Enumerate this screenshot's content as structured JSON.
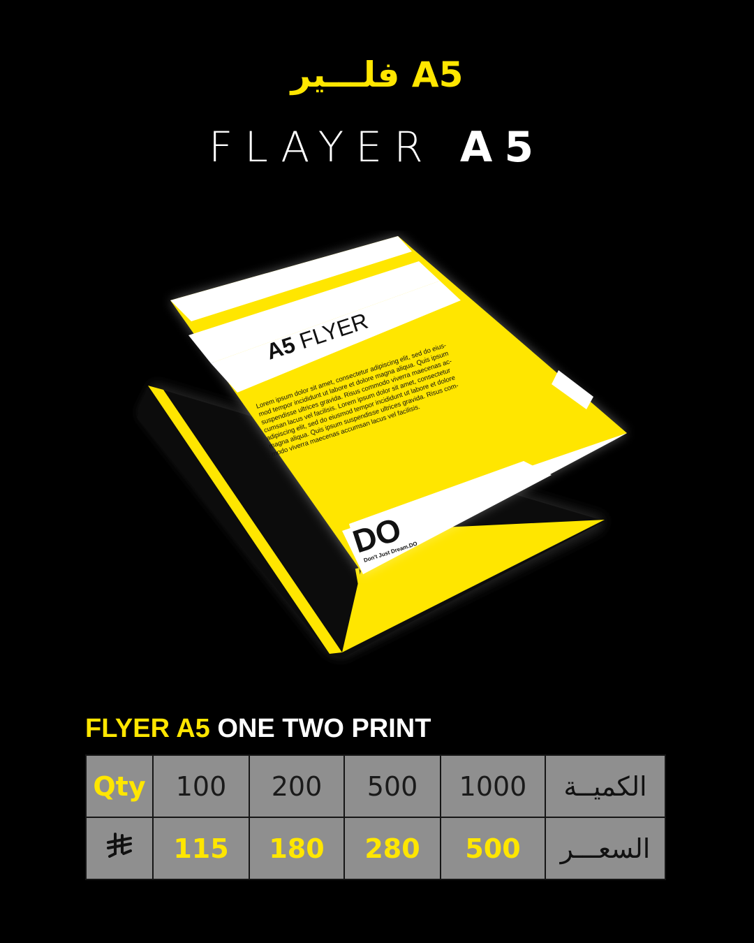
{
  "header": {
    "title_ar": "فلـــير A5",
    "title_en_light": "FLAYER",
    "title_en_bold": "A5"
  },
  "mockup": {
    "front_heading_bold": "A5",
    "front_heading_light": "FLYER",
    "body_lines": [
      "Lorem ipsum dolor sit amet, consectetur adipiscing elit, sed do eius-",
      "mod tempor incididunt ut labore et dolore magna aliqua. Quis ipsum",
      "suspendisse ultrices gravida. Risus commodo viverra maecenas ac-",
      "cumsan lacus vel facilisis. Lorem ipsum dolor sit amet, consectetur",
      "adipiscing elit, sed do eiusmod tempor incididunt ut labore et dolore",
      "magna aliqua. Quis ipsum suspendisse ultrices gravida. Risus com-",
      "modo viverra maecenas accumsan lacus vel facilisis."
    ],
    "logo": "DO",
    "tagline": "Don't Just Dream.DO",
    "back_text": "A5 FLYER"
  },
  "subheading": {
    "accent": "FLYER A5",
    "rest": "ONE TWO PRINT"
  },
  "price_table": {
    "qty_label": "Qty",
    "qty_label_ar": "الكميــة",
    "price_label_ar": "السعـــر",
    "currency_icon": "riyal-symbol-icon",
    "quantities": [
      "100",
      "200",
      "500",
      "1000"
    ],
    "prices": [
      "115",
      "180",
      "280",
      "500"
    ]
  },
  "colors": {
    "accent": "#ffe600",
    "background": "#000000",
    "cell": "#8f8f8f"
  }
}
